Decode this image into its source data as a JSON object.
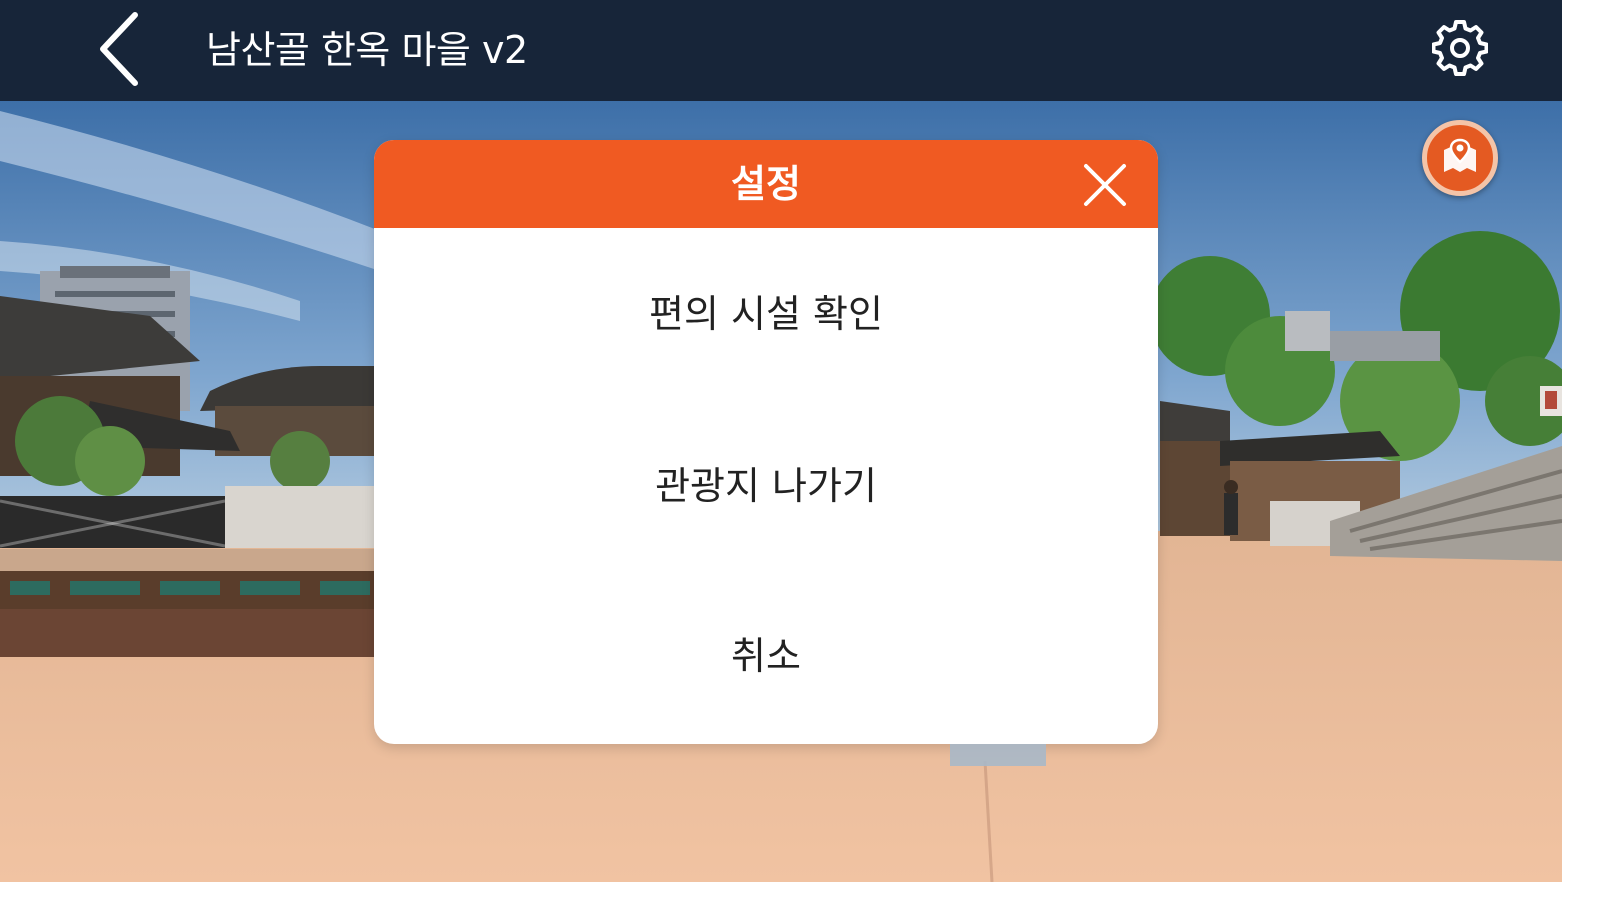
{
  "header": {
    "title": "남산골 한옥 마을 v2",
    "back_icon": "chevron-left-icon",
    "settings_icon": "gear-icon"
  },
  "map_button": {
    "icon": "map-pin-icon"
  },
  "dialog": {
    "title": "설정",
    "close_icon": "close-icon",
    "items": [
      {
        "label": "편의 시설 확인"
      },
      {
        "label": "관광지 나가기"
      },
      {
        "label": "취소"
      }
    ]
  },
  "colors": {
    "topbar": "#172539",
    "accent": "#f05a22",
    "map_button": "#e45a22"
  }
}
